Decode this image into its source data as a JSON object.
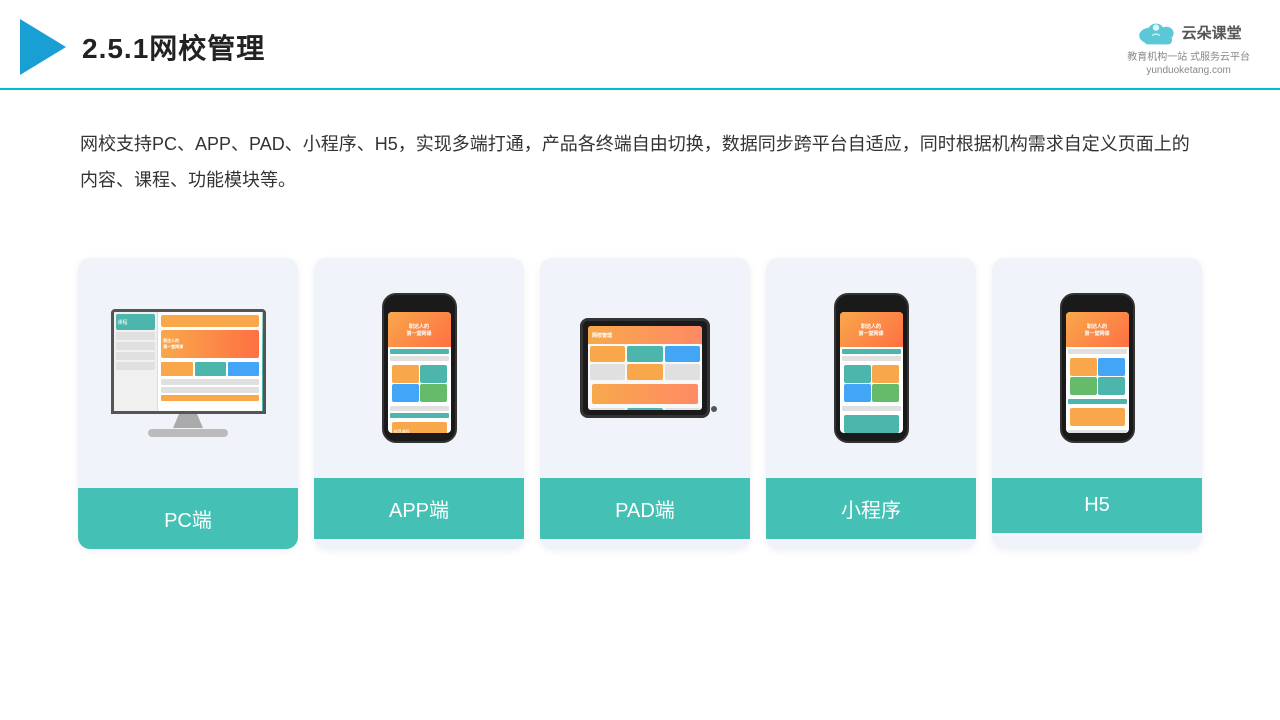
{
  "header": {
    "title": "2.5.1网校管理",
    "brand_name": "云朵课堂",
    "brand_sub1": "教育机构一站",
    "brand_sub2": "式服务云平台",
    "brand_url": "yunduoketang.com"
  },
  "description": {
    "text": "网校支持PC、APP、PAD、小程序、H5，实现多端打通，产品各终端自由切换，数据同步跨平台自适应，同时根据机构需求自定义页面上的内容、课程、功能模块等。"
  },
  "cards": [
    {
      "id": "pc",
      "label": "PC端"
    },
    {
      "id": "app",
      "label": "APP端"
    },
    {
      "id": "pad",
      "label": "PAD端"
    },
    {
      "id": "miniprogram",
      "label": "小程序"
    },
    {
      "id": "h5",
      "label": "H5"
    }
  ]
}
